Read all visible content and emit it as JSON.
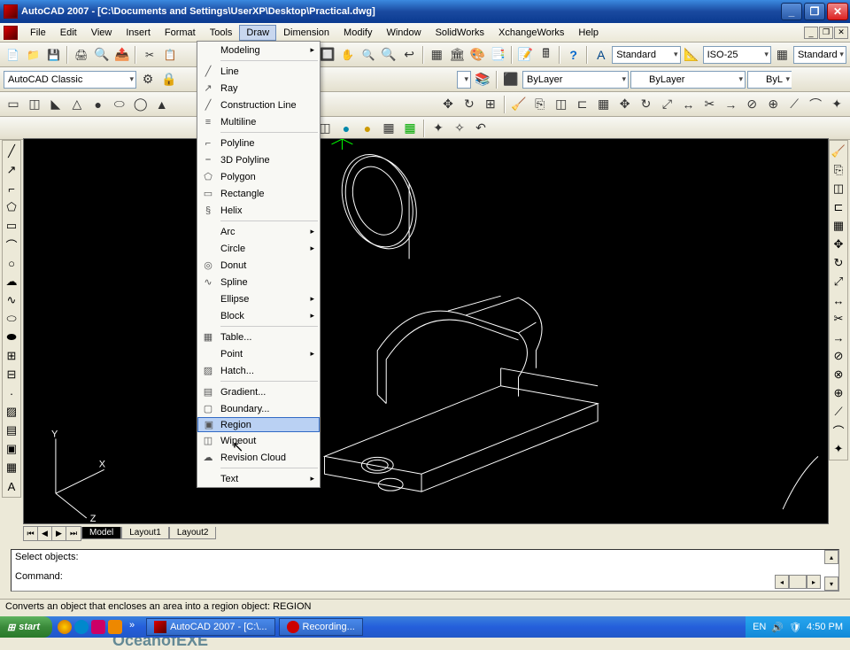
{
  "title": "AutoCAD 2007 - [C:\\Documents and Settings\\UserXP\\Desktop\\Practical.dwg]",
  "menubar": [
    "File",
    "Edit",
    "View",
    "Insert",
    "Format",
    "Tools",
    "Draw",
    "Dimension",
    "Modify",
    "Window",
    "SolidWorks",
    "XchangeWorks",
    "Help"
  ],
  "menu_active_index": 6,
  "toolbar1": {
    "workspace": "AutoCAD Classic"
  },
  "toolbar_top": {
    "text_style": "Standard",
    "dim_style": "ISO-25",
    "table_style": "Standard"
  },
  "layer_row": {
    "layer": "ByLayer",
    "linetype": "ByLayer",
    "ext": "ByL"
  },
  "draw_menu": {
    "items": [
      {
        "label": "Modeling",
        "arrow": true,
        "icon": ""
      },
      {
        "sep": true
      },
      {
        "label": "Line",
        "icon": "╱"
      },
      {
        "label": "Ray",
        "icon": "↗"
      },
      {
        "label": "Construction Line",
        "icon": "╱"
      },
      {
        "label": "Multiline",
        "icon": "≡"
      },
      {
        "sep": true
      },
      {
        "label": "Polyline",
        "icon": "⌐"
      },
      {
        "label": "3D Polyline",
        "icon": "⎯"
      },
      {
        "label": "Polygon",
        "icon": "⬠"
      },
      {
        "label": "Rectangle",
        "icon": "▭"
      },
      {
        "label": "Helix",
        "icon": "§"
      },
      {
        "sep": true
      },
      {
        "label": "Arc",
        "arrow": true,
        "icon": ""
      },
      {
        "label": "Circle",
        "arrow": true,
        "icon": ""
      },
      {
        "label": "Donut",
        "icon": "◎"
      },
      {
        "label": "Spline",
        "icon": "∿"
      },
      {
        "label": "Ellipse",
        "arrow": true,
        "icon": ""
      },
      {
        "label": "Block",
        "arrow": true,
        "icon": ""
      },
      {
        "sep": true
      },
      {
        "label": "Table...",
        "icon": "▦"
      },
      {
        "label": "Point",
        "arrow": true,
        "icon": ""
      },
      {
        "label": "Hatch...",
        "icon": "▨"
      },
      {
        "sep": true
      },
      {
        "label": "Gradient...",
        "icon": "▤"
      },
      {
        "label": "Boundary...",
        "icon": "▢"
      },
      {
        "label": "Region",
        "icon": "▣",
        "highlight": true
      },
      {
        "label": "Wipeout",
        "icon": "◫"
      },
      {
        "label": "Revision Cloud",
        "icon": "☁"
      },
      {
        "sep": true
      },
      {
        "label": "Text",
        "arrow": true,
        "icon": ""
      }
    ]
  },
  "tabs": {
    "active": "Model",
    "items": [
      "Model",
      "Layout1",
      "Layout2"
    ]
  },
  "command": {
    "line1": "Select objects:",
    "line2": "Command:"
  },
  "status": "Converts an object that encloses an area into a region object:  REGION",
  "axes": {
    "x": "X",
    "y": "Y",
    "z": "Z"
  },
  "watermark": "OceanofEXE",
  "taskbar": {
    "start": "start",
    "items": [
      "AutoCAD 2007 - [C:\\...",
      "Recording..."
    ],
    "lang": "EN",
    "time": "4:50 PM"
  }
}
